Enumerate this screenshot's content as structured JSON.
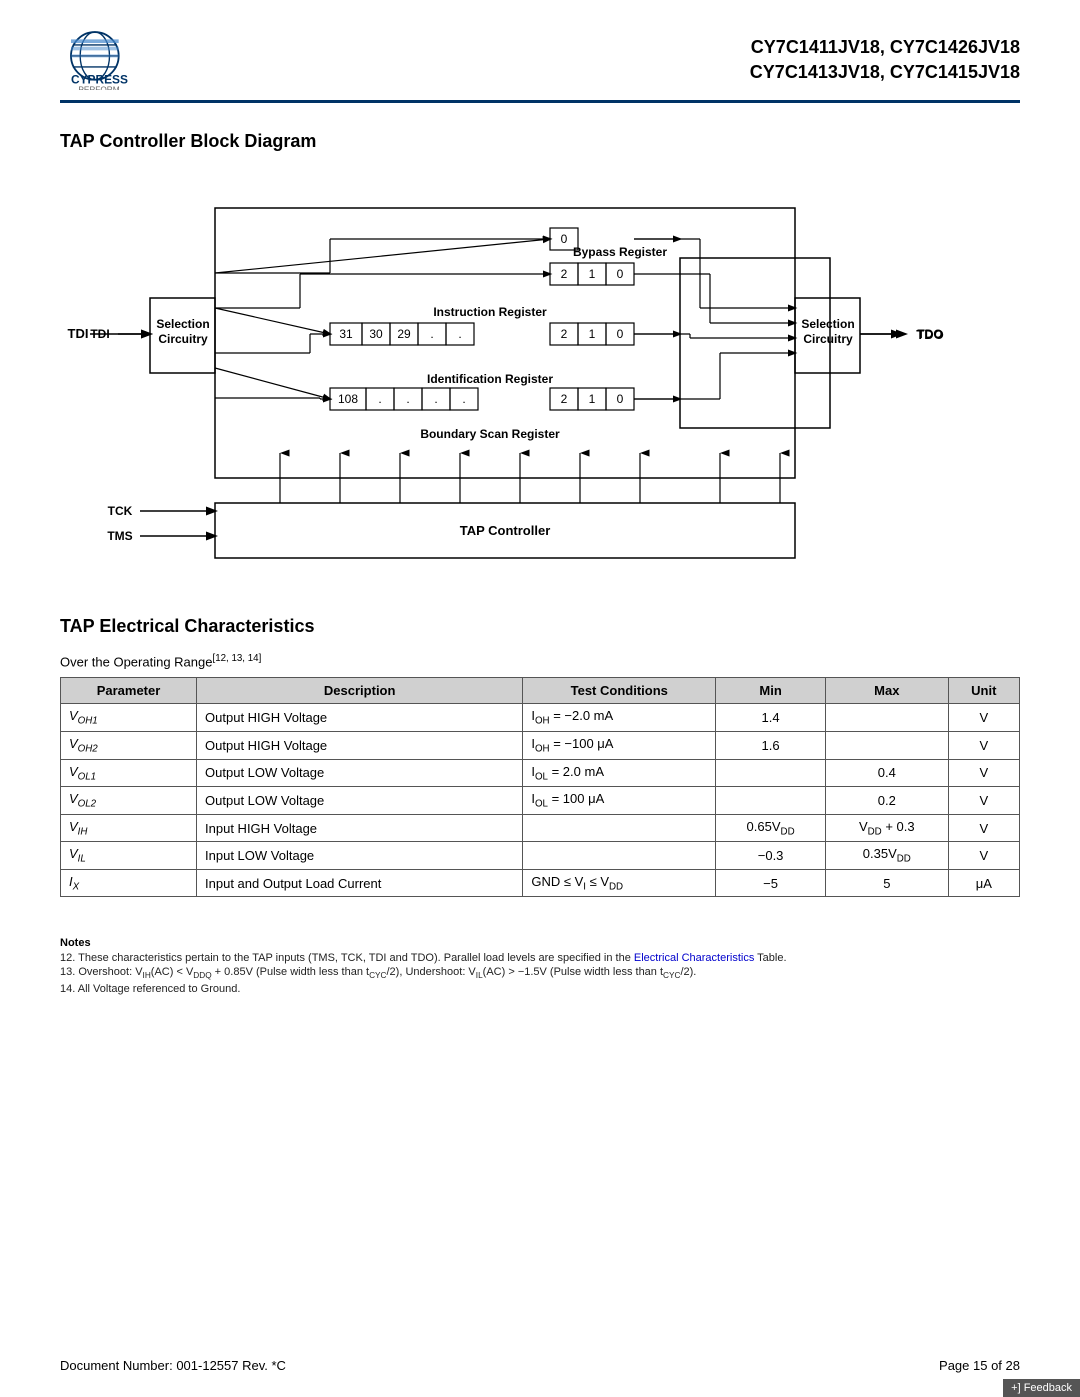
{
  "header": {
    "title_line1": "CY7C1411JV18, CY7C1426JV18",
    "title_line2": "CY7C1413JV18, CY7C1415JV18"
  },
  "section1": {
    "title": "TAP Controller Block Diagram"
  },
  "section2": {
    "title": "TAP Electrical Characteristics",
    "subtitle": "Over the Operating Range",
    "subtitle_sup": "[12, 13, 14]"
  },
  "table": {
    "headers": [
      "Parameter",
      "Description",
      "Test Conditions",
      "Min",
      "Max",
      "Unit"
    ],
    "rows": [
      [
        "V₀H1",
        "Output HIGH Voltage",
        "I₀H = −2.0 mA",
        "1.4",
        "",
        "V"
      ],
      [
        "V₀H2",
        "Output HIGH Voltage",
        "I₀H = −100 μA",
        "1.6",
        "",
        "V"
      ],
      [
        "V₀L1",
        "Output LOW Voltage",
        "I₀L = 2.0 mA",
        "",
        "0.4",
        "V"
      ],
      [
        "V₀L2",
        "Output LOW Voltage",
        "I₀L = 100 μA",
        "",
        "0.2",
        "V"
      ],
      [
        "VᴵH",
        "Input HIGH Voltage",
        "",
        "0.65Vᴰᴰ",
        "Vᴰᴰ + 0.3",
        "V"
      ],
      [
        "VᴵL",
        "Input LOW Voltage",
        "",
        "−0.3",
        "0.35Vᴰᴰ",
        "V"
      ],
      [
        "Iₓ",
        "Input and Output Load Current",
        "GND ≤ Vᴵ ≤ Vᴰᴰ",
        "−5",
        "5",
        "μA"
      ]
    ]
  },
  "notes": {
    "title": "Notes",
    "items": [
      "12. These characteristics pertain to the TAP inputs (TMS, TCK, TDI and TDO). Parallel load levels are specified in the Electrical Characteristics Table.",
      "13. Overshoot: VᴵH(AC) < Vᴰᴰ + 0.85V (Pulse width less than tᶜYC/2), Undershoot: VᴵL(AC) > −1.5V (Pulse width less than tᶜYC/2).",
      "14. All Voltage referenced to Ground."
    ]
  },
  "footer": {
    "doc_number": "Document Number: 001-12557 Rev. *C",
    "page": "Page 15 of 28",
    "feedback": "+] Feedback"
  }
}
